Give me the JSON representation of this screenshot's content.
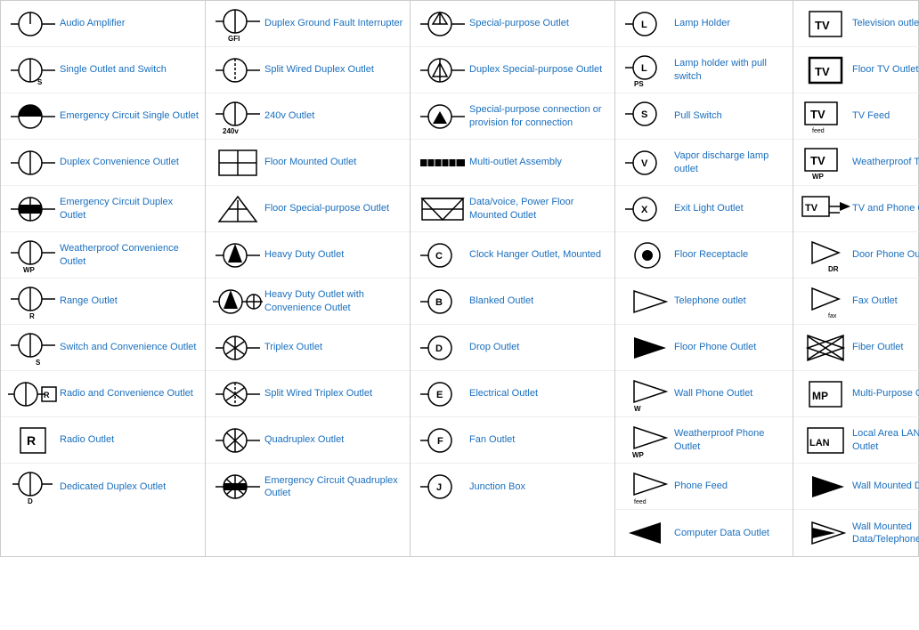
{
  "columns": [
    {
      "items": [
        {
          "id": "audio-amp",
          "label": "Audio Amplifier",
          "sym": "audio-amp"
        },
        {
          "id": "single-outlet-switch",
          "label": "Single Outlet and Switch",
          "sym": "single-outlet-switch",
          "sub": "S"
        },
        {
          "id": "emergency-single",
          "label": "Emergency Circuit Single Outlet",
          "sym": "emergency-single"
        },
        {
          "id": "duplex-convenience",
          "label": "Duplex Convenience Outlet",
          "sym": "duplex-convenience"
        },
        {
          "id": "emergency-duplex",
          "label": "Emergency Circuit Duplex Outlet",
          "sym": "emergency-duplex"
        },
        {
          "id": "weatherproof-convenience",
          "label": "Weatherproof Convenience Outlet",
          "sym": "weatherproof-convenience",
          "sub": "WP"
        },
        {
          "id": "range-outlet",
          "label": "Range Outlet",
          "sym": "range-outlet",
          "sub": "R"
        },
        {
          "id": "switch-convenience",
          "label": "Switch and Convenience Outlet",
          "sym": "switch-convenience",
          "sub": "S"
        },
        {
          "id": "radio-convenience",
          "label": "Radio and Convenience Outlet",
          "sym": "radio-convenience",
          "sub": "R"
        },
        {
          "id": "radio-outlet",
          "label": "Radio Outlet",
          "sym": "radio-outlet",
          "sub": "R"
        },
        {
          "id": "dedicated-duplex",
          "label": "Dedicated Duplex Outlet",
          "sym": "dedicated-duplex",
          "sub": "D"
        }
      ]
    },
    {
      "items": [
        {
          "id": "duplex-gfi",
          "label": "Duplex Ground Fault Interrupter",
          "sym": "duplex-gfi",
          "sub": "GFI"
        },
        {
          "id": "split-wired-duplex",
          "label": "Split Wired Duplex Outlet",
          "sym": "split-wired-duplex"
        },
        {
          "id": "240v-outlet",
          "label": "240v Outlet",
          "sym": "240v-outlet",
          "sub": "240v"
        },
        {
          "id": "floor-mounted",
          "label": "Floor Mounted Outlet",
          "sym": "floor-mounted"
        },
        {
          "id": "floor-special",
          "label": "Floor Special-purpose Outlet",
          "sym": "floor-special"
        },
        {
          "id": "heavy-duty",
          "label": "Heavy Duty Outlet",
          "sym": "heavy-duty"
        },
        {
          "id": "heavy-duty-convenience",
          "label": "Heavy Duty Outlet with Convenience Outlet",
          "sym": "heavy-duty-convenience"
        },
        {
          "id": "triplex",
          "label": "Triplex Outlet",
          "sym": "triplex"
        },
        {
          "id": "split-wired-triplex",
          "label": "Split Wired Triplex Outlet",
          "sym": "split-wired-triplex"
        },
        {
          "id": "quadruplex",
          "label": "Quadruplex Outlet",
          "sym": "quadruplex"
        },
        {
          "id": "emergency-quadruplex",
          "label": "Emergency Circuit Quadruplex Outlet",
          "sym": "emergency-quadruplex"
        }
      ]
    },
    {
      "items": [
        {
          "id": "special-purpose",
          "label": "Special-purpose Outlet",
          "sym": "special-purpose"
        },
        {
          "id": "duplex-special-purpose",
          "label": "Duplex Special-purpose Outlet",
          "sym": "duplex-special-purpose"
        },
        {
          "id": "special-connection",
          "label": "Special-purpose connection or provision for connection",
          "sym": "special-connection"
        },
        {
          "id": "multi-outlet-assembly",
          "label": "Multi-outlet Assembly",
          "sym": "multi-outlet-assembly"
        },
        {
          "id": "data-voice-power",
          "label": "Data/voice, Power Floor Mounted Outlet",
          "sym": "data-voice-power"
        },
        {
          "id": "clock-hanger",
          "label": "Clock Hanger Outlet, Mounted",
          "sym": "clock-hanger",
          "sub": "C"
        },
        {
          "id": "blanked-outlet",
          "label": "Blanked Outlet",
          "sym": "blanked-outlet",
          "sub": "B"
        },
        {
          "id": "drop-outlet",
          "label": "Drop Outlet",
          "sym": "drop-outlet",
          "sub": "D"
        },
        {
          "id": "electrical-outlet",
          "label": "Electrical Outlet",
          "sym": "electrical-outlet",
          "sub": "E"
        },
        {
          "id": "fan-outlet",
          "label": "Fan Outlet",
          "sym": "fan-outlet",
          "sub": "F"
        },
        {
          "id": "junction-box",
          "label": "Junction Box",
          "sym": "junction-box",
          "sub": "J"
        }
      ]
    },
    {
      "items": [
        {
          "id": "lamp-holder",
          "label": "Lamp Holder",
          "sym": "lamp-holder",
          "sub": "L"
        },
        {
          "id": "lamp-holder-pull",
          "label": "Lamp holder with pull switch",
          "sym": "lamp-holder-pull",
          "sub": "PS"
        },
        {
          "id": "pull-switch",
          "label": "Pull Switch",
          "sym": "pull-switch",
          "sub": "S"
        },
        {
          "id": "vapor-discharge",
          "label": "Vapor discharge lamp outlet",
          "sym": "vapor-discharge",
          "sub": "V"
        },
        {
          "id": "exit-light",
          "label": "Exit Light Outlet",
          "sym": "exit-light",
          "sub": "X"
        },
        {
          "id": "floor-receptacle",
          "label": "Floor Receptacle",
          "sym": "floor-receptacle"
        },
        {
          "id": "telephone-outlet",
          "label": "Telephone outlet",
          "sym": "telephone-outlet"
        },
        {
          "id": "floor-phone",
          "label": "Floor Phone Outlet",
          "sym": "floor-phone"
        },
        {
          "id": "wall-phone",
          "label": "Wall Phone Outlet",
          "sym": "wall-phone",
          "sub": "W"
        },
        {
          "id": "weatherproof-phone",
          "label": "Weatherproof Phone Outlet",
          "sym": "weatherproof-phone",
          "sub": "WP"
        },
        {
          "id": "phone-feed",
          "label": "Phone Feed",
          "sym": "phone-feed",
          "sub": "feed"
        },
        {
          "id": "computer-data",
          "label": "Computer Data Outlet",
          "sym": "computer-data"
        }
      ]
    },
    {
      "items": [
        {
          "id": "television-outlet",
          "label": "Television outlet",
          "sym": "television-outlet"
        },
        {
          "id": "floor-tv",
          "label": "Floor TV Outlet",
          "sym": "floor-tv"
        },
        {
          "id": "tv-feed",
          "label": "TV Feed",
          "sym": "tv-feed",
          "sub": "feed"
        },
        {
          "id": "weatherproof-tv",
          "label": "Weatherproof TV Outlet",
          "sym": "weatherproof-tv",
          "sub": "WP"
        },
        {
          "id": "tv-phone",
          "label": "TV and Phone Outlet",
          "sym": "tv-phone"
        },
        {
          "id": "door-phone",
          "label": "Door Phone Outlet",
          "sym": "door-phone",
          "sub": "DR"
        },
        {
          "id": "fax-outlet",
          "label": "Fax Outlet",
          "sym": "fax-outlet",
          "sub": "fax"
        },
        {
          "id": "fiber-outlet",
          "label": "Fiber Outlet",
          "sym": "fiber-outlet"
        },
        {
          "id": "multi-purpose",
          "label": "Multi-Purpose Outlet",
          "sym": "multi-purpose",
          "sub": "MP"
        },
        {
          "id": "lan-outlet",
          "label": "Local Area LAN Network Outlet",
          "sym": "lan-outlet",
          "sub": "LAN"
        },
        {
          "id": "wall-mounted-data",
          "label": "Wall Mounted Data Outlet",
          "sym": "wall-mounted-data"
        },
        {
          "id": "wall-mounted-data-tel",
          "label": "Wall Mounted Data/Telephone Outlet",
          "sym": "wall-mounted-data-tel"
        }
      ]
    }
  ]
}
